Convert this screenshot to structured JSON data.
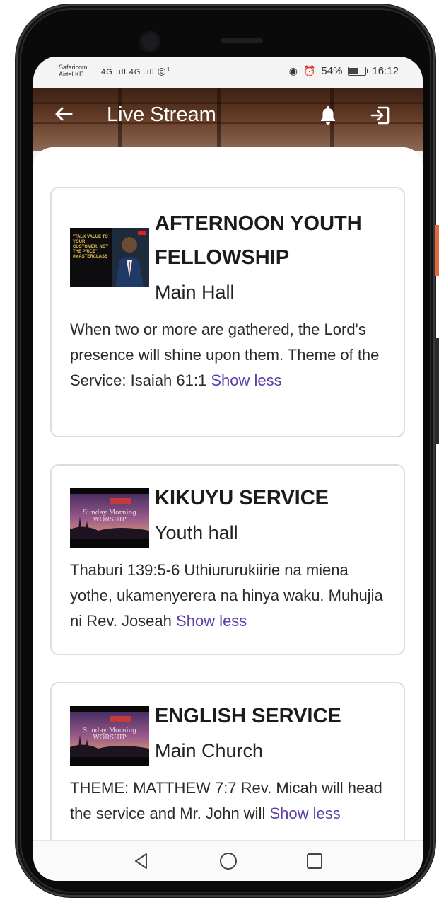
{
  "status_bar": {
    "carrier_1": "Safaricom",
    "carrier_2": "Airtel KE",
    "signal_text": "4G .ıll 4G .ıll",
    "hotspot_badge": "1",
    "battery": "54%",
    "time": "16:12"
  },
  "appbar": {
    "title": "Live Stream",
    "back_icon": "arrow-left-icon",
    "notification_icon": "bell-icon",
    "logout_icon": "logout-icon"
  },
  "services": [
    {
      "title": "AFTERNOON YOUTH FELLOWSHIP",
      "location": "Main Hall",
      "description": "When two or more are gathered, the Lord's presence will shine upon them. Theme of the Service: Isaiah 61:1",
      "toggle": "Show less",
      "thumbnail": "speaker-video-thumbnail",
      "thumb_caption": "\"TALK VALUE TO YOUR CUSTOMER, NOT THE PRICE\" #MASTERCLASS"
    },
    {
      "title": "KIKUYU SERVICE",
      "location": "Youth hall",
      "description": "Thaburi 139:5-6 Uthiururukiirie na miena yothe, ukamenyerera na hinya waku. Muhujia ni Rev. Joseah",
      "toggle": "Show less",
      "thumbnail": "sunday-worship-thumbnail",
      "thumb_caption": "Sunday Morning WORSHIP"
    },
    {
      "title": "ENGLISH SERVICE",
      "location": "Main Church",
      "description": "THEME: MATTHEW 7:7 Rev. Micah will head the service and Mr. John will",
      "toggle": "Show less",
      "thumbnail": "sunday-worship-thumbnail",
      "thumb_caption": "Sunday Morning WORSHIP"
    }
  ],
  "navbar": {
    "back": "triangle-back-icon",
    "home": "circle-home-icon",
    "recents": "square-recents-icon"
  },
  "colors": {
    "link": "#5b3ea6",
    "card_border": "#dcdcdc",
    "appbar_wood": "#6f4631"
  }
}
